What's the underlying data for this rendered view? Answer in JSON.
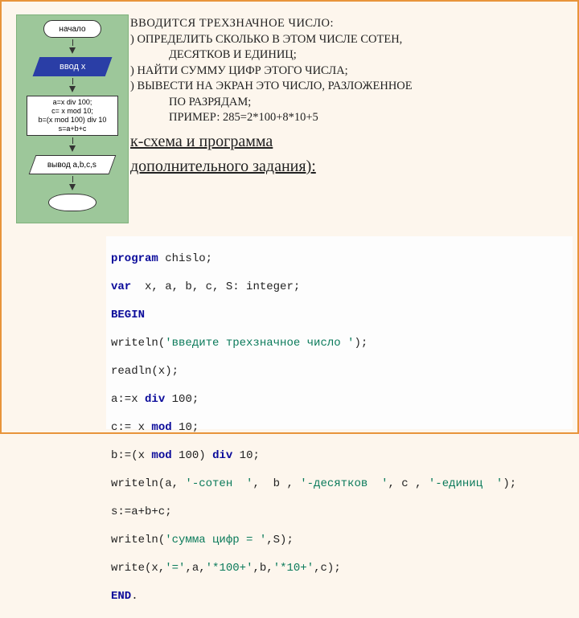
{
  "flowchart": {
    "start": "начало",
    "input": "ввод x",
    "process": "a=x div 100;\nc= x mod 10;\nb=(x mod 100) div 10\ns=a+b+c",
    "output": "вывод a,b,c,s",
    "end": ""
  },
  "task": {
    "title": "ВВОДИТСЯ ТРЕХЗНАЧНОЕ ЧИСЛО:",
    "l1a": ") ОПРЕДЕЛИТЬ СКОЛЬКО В ЭТОМ ЧИСЛЕ СОТЕН,",
    "l1b": "ДЕСЯТКОВ  И ЕДИНИЦ;",
    "l2": ") НАЙТИ СУММУ ЦИФР ЭТОГО ЧИСЛА;",
    "l3a": ") ВЫВЕСТИ НА ЭКРАН ЭТО ЧИСЛО, РАЗЛОЖЕННОЕ",
    "l3b": "ПО РАЗРЯДАМ;",
    "ex": "ПРИМЕР:  285=2*100+8*10+5",
    "scheme1": "к-схема и программа",
    "scheme2": " дополнительного задания):"
  },
  "code": {
    "kw_program": "program",
    "id_prog": " chislo;",
    "kw_var": "var",
    "decl": "  x, a, b, c, S: integer;",
    "kw_begin": "BEGIN",
    "w1a": "writeln(",
    "s1": "'введите трехзначное число '",
    "w1b": ");",
    "read": "readln(x);",
    "a_pre": "a:=x ",
    "kw_div1": "div",
    "a_post": " 100;",
    "c_pre": "c:= x ",
    "kw_mod1": "mod",
    "c_post": " 10;",
    "b_pre": "b:=(x ",
    "kw_mod2": "mod",
    "b_mid": " 100) ",
    "kw_div2": "div",
    "b_post": " 10;",
    "w2a": "writeln(a, ",
    "s2a": "'-сотен  '",
    "w2b": ",  b , ",
    "s2b": "'-десятков  '",
    "w2c": ", c , ",
    "s2c": "'-единиц  '",
    "w2d": ");",
    "ssum": "s:=a+b+c;",
    "w3a": "writeln(",
    "s3": "'сумма цифр = '",
    "w3b": ",S);",
    "w4a": "write(x,",
    "s4a": "'='",
    "w4b": ",a,",
    "s4b": "'*100+'",
    "w4c": ",b,",
    "s4c": "'*10+'",
    "w4d": ",c);",
    "kw_end": "END",
    "end_dot": "."
  }
}
